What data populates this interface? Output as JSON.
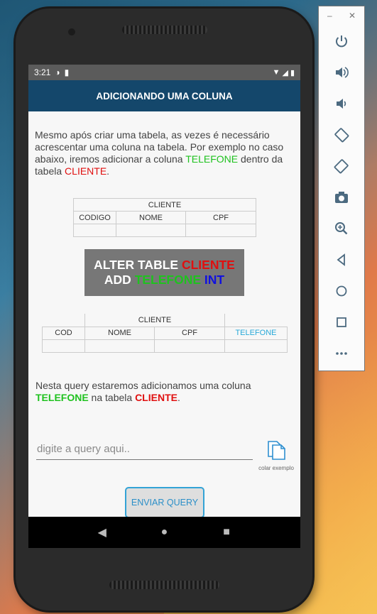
{
  "status": {
    "time": "3:21"
  },
  "appbar": {
    "title": "ADICIONANDO UMA COLUNA"
  },
  "intro": {
    "text": "Mesmo após criar uma tabela, as vezes é necessário acrescentar uma coluna na tabela. Por exemplo no caso abaixo, iremos adicionar a coluna ",
    "column": "TELEFONE",
    "mid": " dentro da tabela ",
    "table": "CLIENTE",
    "end": "."
  },
  "table_before": {
    "title": "CLIENTE",
    "headers": [
      "CODIGO",
      "NOME",
      "CPF"
    ]
  },
  "sql": {
    "line1_kw": "ALTER TABLE ",
    "line1_table": "CLIENTE",
    "line2_kw": "ADD ",
    "line2_col": "TELEFONE",
    "line2_type": " INT"
  },
  "table_after": {
    "title": "CLIENTE",
    "headers": [
      "COD",
      "NOME",
      "CPF",
      "TELEFONE"
    ]
  },
  "explain": {
    "text": "Nesta query estaremos adicionamos uma coluna ",
    "column": "TELEFONE",
    "mid": " na tabela ",
    "table": "CLIENTE",
    "end": "."
  },
  "query": {
    "placeholder": "digite a query aqui.."
  },
  "paste": {
    "label": "colar exemplo"
  },
  "send": {
    "label": "ENVIAR QUERY"
  },
  "colors": {
    "appbar": "#14476b",
    "green": "#1fc21f",
    "red": "#e01010",
    "blue": "#1010e0",
    "accent": "#33a3d6"
  }
}
